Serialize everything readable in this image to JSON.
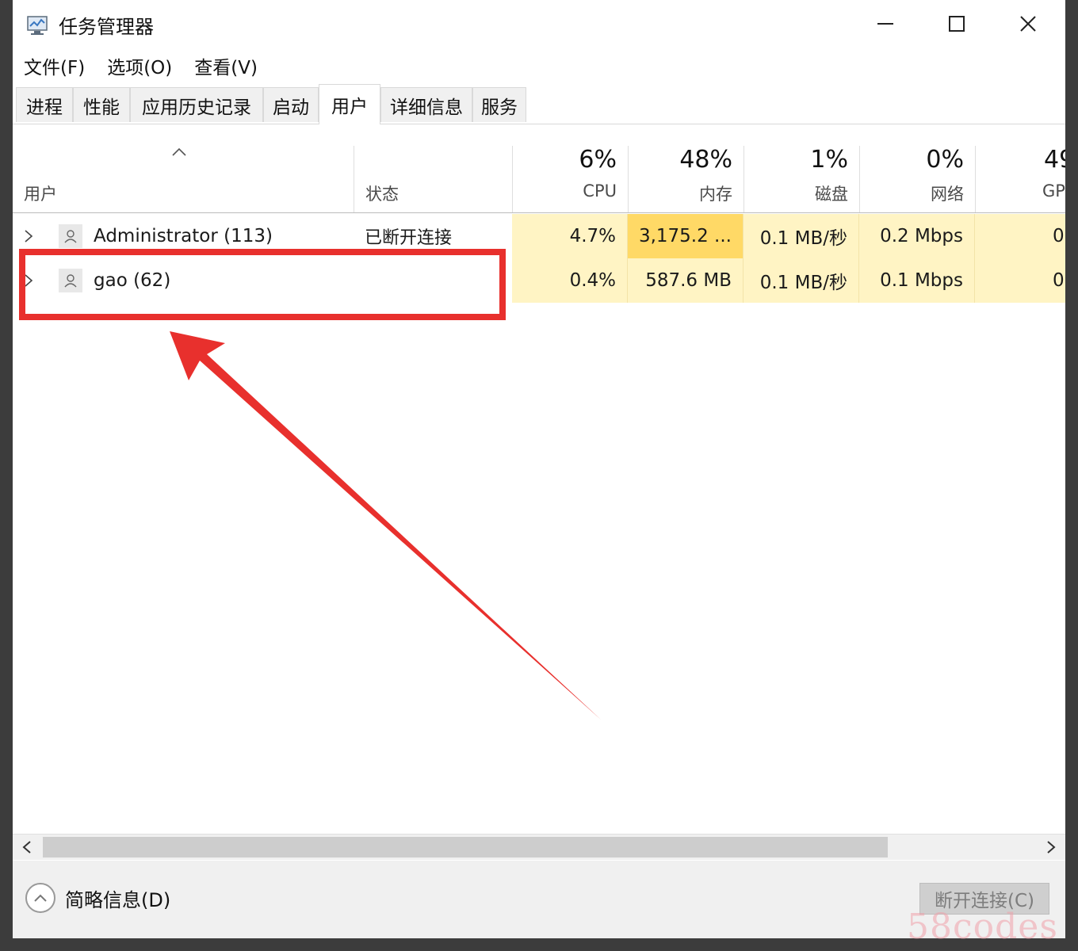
{
  "window": {
    "title": "任务管理器",
    "icon": "task-manager-icon"
  },
  "menu": [
    "文件(F)",
    "选项(O)",
    "查看(V)"
  ],
  "tabs": [
    {
      "label": "进程",
      "active": false
    },
    {
      "label": "性能",
      "active": false
    },
    {
      "label": "应用历史记录",
      "active": false
    },
    {
      "label": "启动",
      "active": false
    },
    {
      "label": "用户",
      "active": true
    },
    {
      "label": "详细信息",
      "active": false
    },
    {
      "label": "服务",
      "active": false
    }
  ],
  "header": {
    "user_label": "用户",
    "status_label": "状态",
    "columns": [
      {
        "pct": "6%",
        "label": "CPU"
      },
      {
        "pct": "48%",
        "label": "内存"
      },
      {
        "pct": "1%",
        "label": "磁盘"
      },
      {
        "pct": "0%",
        "label": "网络"
      },
      {
        "pct": "49",
        "label": "GPU"
      }
    ]
  },
  "rows": [
    {
      "name": "Administrator (113)",
      "status": "已断开连接",
      "cpu": "4.7%",
      "memory": "3,175.2 ...",
      "disk": "0.1 MB/秒",
      "network": "0.2 Mbps",
      "gpu": "0"
    },
    {
      "name": "gao (62)",
      "status": "",
      "cpu": "0.4%",
      "memory": "587.6 MB",
      "disk": "0.1 MB/秒",
      "network": "0.1 Mbps",
      "gpu": "0"
    }
  ],
  "footer": {
    "fewer_details": "简略信息(D)",
    "disconnect_button": "断开连接(C)"
  },
  "watermark": "58codes",
  "colors": {
    "heat_light": "#fff4c4",
    "heat_medium": "#ffd966",
    "annotation_red": "#e8302d"
  }
}
